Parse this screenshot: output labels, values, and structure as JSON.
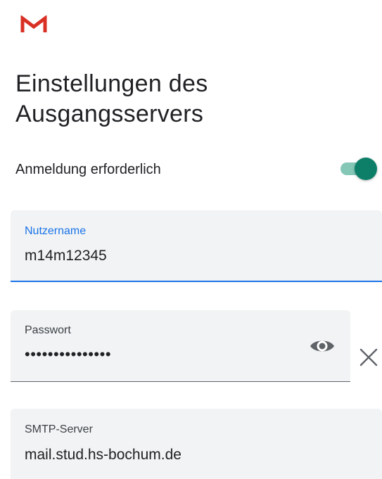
{
  "app": {
    "logo": "gmail-logo",
    "brand_color": "#d93025"
  },
  "page": {
    "title": "Einstellungen des Ausgangsservers"
  },
  "auth": {
    "label": "Anmeldung erforderlich",
    "enabled": true,
    "accent": "#0d7f68"
  },
  "fields": {
    "username": {
      "label": "Nutzername",
      "value": "m14m12345",
      "focused": true
    },
    "password": {
      "label": "Passwort",
      "value": "•••••••••••••••",
      "icons": [
        "eye-icon",
        "close-icon"
      ]
    },
    "smtp": {
      "label": "SMTP-Server",
      "value": "mail.stud.hs-bochum.de"
    }
  }
}
